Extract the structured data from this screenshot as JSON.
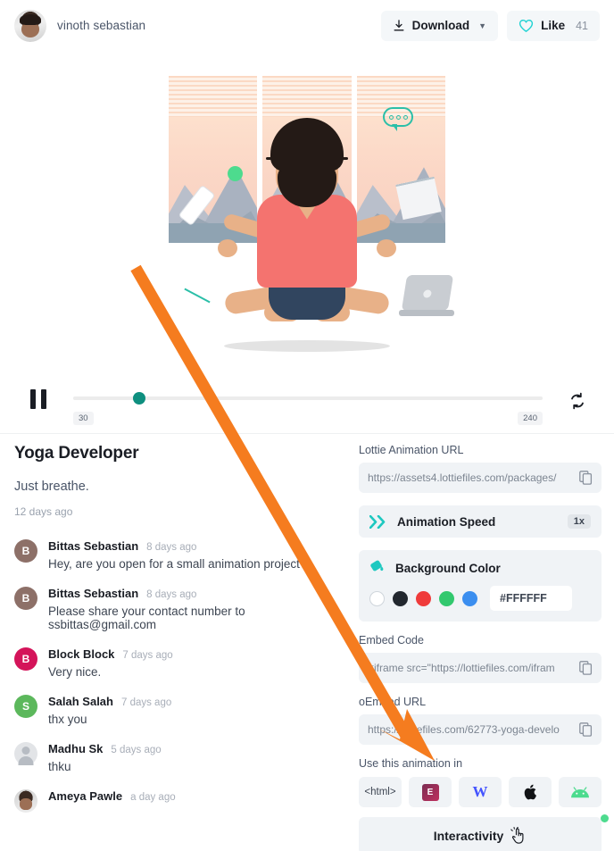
{
  "header": {
    "author_name": "vinoth sebastian",
    "avatar_icon": "user-photo-avatar",
    "download_label": "Download",
    "download_icon": "download-icon",
    "caret_icon": "chevron-down-icon",
    "like_label": "Like",
    "like_icon": "heart-icon",
    "like_count": "41"
  },
  "player": {
    "pause_icon": "pause-icon",
    "loop_icon": "loop-icon",
    "start_frame": "30",
    "end_frame": "240",
    "thumb_color": "#0e8f7f"
  },
  "detail": {
    "title": "Yoga Developer",
    "description": "Just breathe.",
    "age": "12 days ago"
  },
  "comments": [
    {
      "avatar_letter": "B",
      "avatar_color": "#8d7068",
      "avatar_type": "letter",
      "name": "Bittas Sebastian",
      "time": "8 days ago",
      "text": "Hey, are you open for a small animation project?"
    },
    {
      "avatar_letter": "B",
      "avatar_color": "#8d7068",
      "avatar_type": "letter",
      "name": "Bittas Sebastian",
      "time": "8 days ago",
      "text": "Please share your contact number to ssbittas@gmail.com"
    },
    {
      "avatar_letter": "B",
      "avatar_color": "#d4145a",
      "avatar_type": "letter",
      "name": "Block Block",
      "time": "7 days ago",
      "text": "Very nice."
    },
    {
      "avatar_letter": "S",
      "avatar_color": "#5cb85c",
      "avatar_type": "letter",
      "name": "Salah Salah",
      "time": "7 days ago",
      "text": "thx you"
    },
    {
      "avatar_letter": "",
      "avatar_color": "#e2e4e7",
      "avatar_type": "anon",
      "name": "Madhu Sk",
      "time": "5 days ago",
      "text": "thku"
    },
    {
      "avatar_letter": "",
      "avatar_color": "#cccccc",
      "avatar_type": "photo",
      "name": "Ameya Pawle",
      "time": "a day ago",
      "text": ""
    }
  ],
  "sidebar": {
    "lottie_url_label": "Lottie Animation URL",
    "lottie_url_value": "https://assets4.lottiefiles.com/packages/",
    "copy_icon": "copy-icon",
    "speed_label": "Animation Speed",
    "speed_icon": "fast-forward-icon",
    "speed_value": "1x",
    "bg_label": "Background Color",
    "bg_icon": "paint-bucket-icon",
    "bg_hex": "#FFFFFF",
    "swatches": [
      "#FFFFFF",
      "#22272e",
      "#ef3b3b",
      "#32c86e",
      "#3b8eef"
    ],
    "embed_label": "Embed Code",
    "embed_value": "<iframe src=\"https://lottiefiles.com/ifram",
    "oembed_label": "oEmbed URL",
    "oembed_value": "https://lottiefiles.com/62773-yoga-develo",
    "use_label": "Use this animation in",
    "platforms": [
      {
        "name": "html-platform-button",
        "label": "<html>",
        "icon": "html-icon"
      },
      {
        "name": "elementor-platform-button",
        "label": "E",
        "icon": "elementor-icon"
      },
      {
        "name": "webflow-platform-button",
        "label": "W",
        "icon": "webflow-icon"
      },
      {
        "name": "apple-platform-button",
        "label": "",
        "icon": "apple-icon"
      },
      {
        "name": "android-platform-button",
        "label": "",
        "icon": "android-icon"
      }
    ],
    "interactivity_label": "Interactivity",
    "interactivity_icon": "cursor-click-icon",
    "status_dot_color": "#4ddb8e"
  },
  "annotation": {
    "arrow_color": "#f57c1f",
    "arrow_name": "orange-pointer-arrow"
  },
  "artwork": {
    "name": "yoga-meditation-animation",
    "alt": "Man meditating in lotus pose in front of windows with mountain view"
  }
}
